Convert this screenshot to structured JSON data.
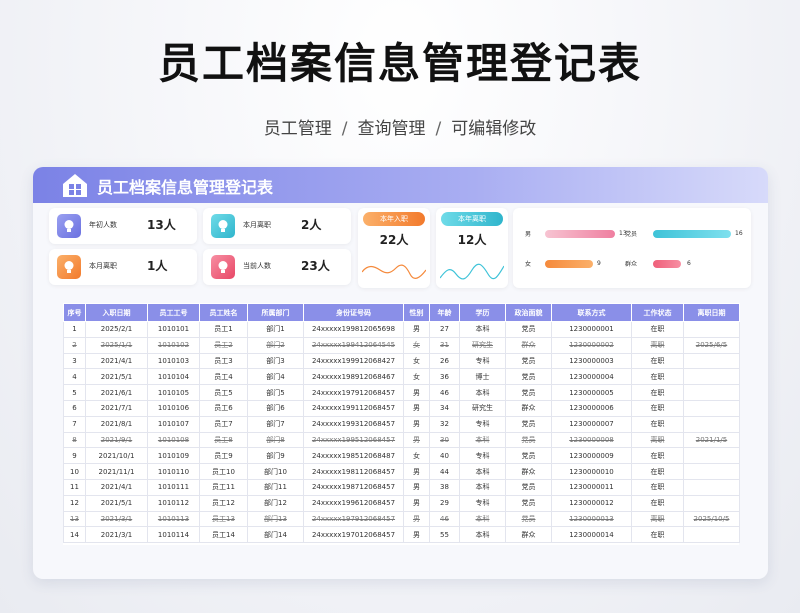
{
  "page": {
    "main_title": "员工档案信息管理登记表",
    "subtitle_parts": [
      "员工管理",
      "查询管理",
      "可编辑修改"
    ],
    "separator": "/"
  },
  "header": {
    "title": "员工档案信息管理登记表",
    "icon": "building-icon"
  },
  "stats": [
    {
      "label": "年初人数",
      "value": "13人",
      "color": "#7b82e6",
      "icon": "lightbulb-icon"
    },
    {
      "label": "本月离职",
      "value": "2人",
      "color": "#3ec3d8",
      "icon": "lightbulb-icon"
    },
    {
      "label": "本月离职",
      "value": "1人",
      "color": "#f58a3c",
      "icon": "lightbulb-icon"
    },
    {
      "label": "当前人数",
      "value": "23人",
      "color": "#ef5f7a",
      "icon": "lightbulb-icon"
    }
  ],
  "mini_cards": [
    {
      "label": "本年入职",
      "value": "22人",
      "color": "#f58a3c"
    },
    {
      "label": "本年离职",
      "value": "12人",
      "color": "#3ec3d8"
    }
  ],
  "bar_stats": [
    {
      "label": "男",
      "value": 13,
      "color": "#ef7fa0"
    },
    {
      "label": "党员",
      "value": 16,
      "color": "#3ec3d8"
    },
    {
      "label": "女",
      "value": 9,
      "color": "#f58a3c"
    },
    {
      "label": "群众",
      "value": 6,
      "color": "#ef5f7a"
    }
  ],
  "table": {
    "headers": [
      "序号",
      "入职日期",
      "员工工号",
      "员工姓名",
      "所属部门",
      "身份证号码",
      "性别",
      "年龄",
      "学历",
      "政治面貌",
      "联系方式",
      "工作状态",
      "离职日期"
    ],
    "rows": [
      [
        "1",
        "2025/2/1",
        "1010101",
        "员工1",
        "部门1",
        "24xxxxx19981206569​8",
        "男",
        "27",
        "本科",
        "党员",
        "1230000001",
        "在职",
        ""
      ],
      [
        "2",
        "2025/1/1",
        "1010102",
        "员工2",
        "部门2",
        "24xxxxx19941206454​5",
        "女",
        "31",
        "研究生",
        "群众",
        "1230000002",
        "离职",
        "2025/6/5"
      ],
      [
        "3",
        "2021/4/1",
        "1010103",
        "员工3",
        "部门3",
        "24xxxxx19991206842​7",
        "女",
        "26",
        "专科",
        "党员",
        "1230000003",
        "在职",
        ""
      ],
      [
        "4",
        "2021/5/1",
        "1010104",
        "员工4",
        "部门4",
        "24xxxxx19891206846​7",
        "女",
        "36",
        "博士",
        "党员",
        "1230000004",
        "在职",
        ""
      ],
      [
        "5",
        "2021/6/1",
        "1010105",
        "员工5",
        "部门5",
        "24xxxxx19791206845​7",
        "男",
        "46",
        "本科",
        "党员",
        "1230000005",
        "在职",
        ""
      ],
      [
        "6",
        "2021/7/1",
        "1010106",
        "员工6",
        "部门6",
        "24xxxxx19911206845​7",
        "男",
        "34",
        "研究生",
        "群众",
        "1230000006",
        "在职",
        ""
      ],
      [
        "7",
        "2021/8/1",
        "1010107",
        "员工7",
        "部门7",
        "24xxxxx19931206845​7",
        "男",
        "32",
        "专科",
        "党员",
        "1230000007",
        "在职",
        ""
      ],
      [
        "8",
        "2021/9/1",
        "1010108",
        "员工8",
        "部门8",
        "24xxxxx19951206845​7",
        "男",
        "30",
        "本科",
        "党员",
        "1230000008",
        "离职",
        "2021/1/5"
      ],
      [
        "9",
        "2021/10/1",
        "1010109",
        "员工9",
        "部门9",
        "24xxxxx19851206848​7",
        "女",
        "40",
        "专科",
        "党员",
        "1230000009",
        "在职",
        ""
      ],
      [
        "10",
        "2021/11/1",
        "1010110",
        "员工10",
        "部门10",
        "24xxxxx19811206845​7",
        "男",
        "44",
        "本科",
        "群众",
        "1230000010",
        "在职",
        ""
      ],
      [
        "11",
        "2021/4/1",
        "1010111",
        "员工11",
        "部门11",
        "24xxxxx19871206845​7",
        "男",
        "38",
        "本科",
        "党员",
        "1230000011",
        "在职",
        ""
      ],
      [
        "12",
        "2021/5/1",
        "1010112",
        "员工12",
        "部门12",
        "24xxxxx19961206845​7",
        "男",
        "29",
        "专科",
        "党员",
        "1230000012",
        "在职",
        ""
      ],
      [
        "13",
        "2021/3/1",
        "1010113",
        "员工13",
        "部门13",
        "24xxxxx19791206845​7",
        "男",
        "46",
        "本科",
        "党员",
        "1230000013",
        "离职",
        "2025/10/5"
      ],
      [
        "14",
        "2021/3/1",
        "1010114",
        "员工14",
        "部门14",
        "24xxxxx19701206845​7",
        "男",
        "55",
        "本科",
        "群众",
        "1230000014",
        "在职",
        ""
      ]
    ]
  }
}
